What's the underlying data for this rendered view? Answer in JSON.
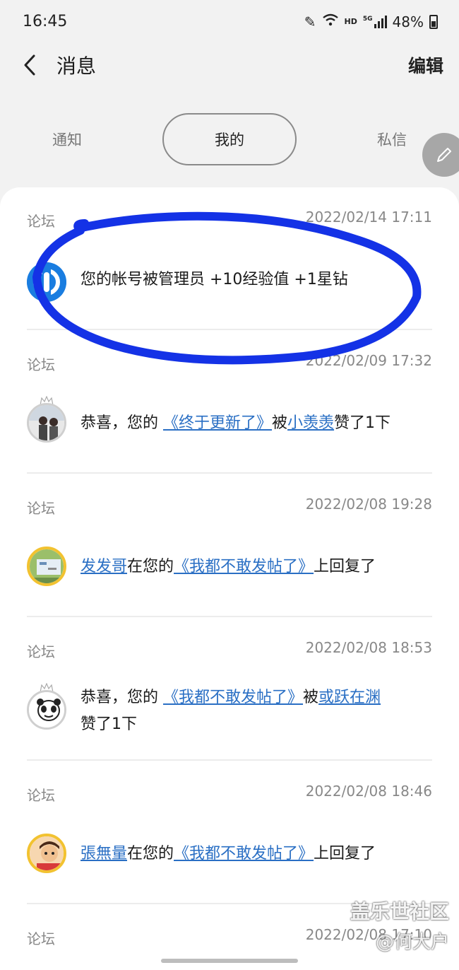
{
  "status_bar": {
    "time": "16:45",
    "hd": "HD",
    "net": "5G",
    "battery": "48%"
  },
  "header": {
    "title": "消息",
    "edit": "编辑",
    "back_icon": "chevron-left-icon"
  },
  "tabs": [
    {
      "label": "通知",
      "active": false
    },
    {
      "label": "我的",
      "active": true
    },
    {
      "label": "私信",
      "active": false
    }
  ],
  "colors": {
    "link": "#2a6fc4",
    "scribble": "#1432e6"
  },
  "messages": [
    {
      "source": "论坛",
      "time": "2022/02/14 17:11",
      "text": "您的帐号被管理员 +10经验值 +1星钻"
    },
    {
      "source": "论坛",
      "time": "2022/02/09 17:32",
      "pre": "恭喜，您的 ",
      "link1": "《终于更新了》",
      "mid": "被",
      "link2": "小羡羡",
      "post": "赞了1下"
    },
    {
      "source": "论坛",
      "time": "2022/02/08 19:28",
      "link1": "发发哥",
      "mid": "在您的",
      "link2": "《我都不敢发帖了》",
      "post": "上回复了"
    },
    {
      "source": "论坛",
      "time": "2022/02/08 18:53",
      "pre": "恭喜，您的 ",
      "link1": "《我都不敢发帖了》",
      "mid": "被",
      "link2": "或跃在渊",
      "post": "赞了1下"
    },
    {
      "source": "论坛",
      "time": "2022/02/08 18:46",
      "link1": "張無量",
      "mid": "在您的",
      "link2": "《我都不敢发帖了》",
      "post": "上回复了"
    },
    {
      "source": "论坛",
      "time": "2022/02/08 17:10"
    }
  ],
  "watermark": {
    "line1": "盖乐世社区",
    "line2": "@何大户"
  }
}
